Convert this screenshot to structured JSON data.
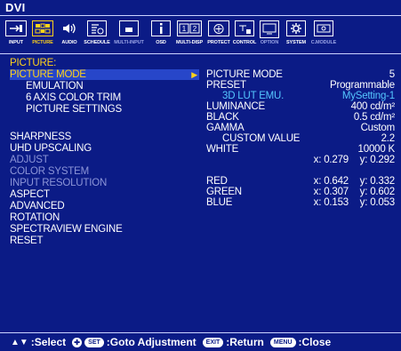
{
  "title": "DVI",
  "toolbar": [
    {
      "label": "INPUT",
      "icon": "input-icon"
    },
    {
      "label": "PICTURE",
      "icon": "picture-icon"
    },
    {
      "label": "AUDIO",
      "icon": "audio-icon"
    },
    {
      "label": "SCHEDULE",
      "icon": "schedule-icon"
    },
    {
      "label": "MULTI-INPUT",
      "icon": "multi-input-icon"
    },
    {
      "label": "OSD",
      "icon": "osd-icon"
    },
    {
      "label": "MULTI-DISP",
      "icon": "multi-display-icon"
    },
    {
      "label": "PROTECT",
      "icon": "protect-icon"
    },
    {
      "label": "CONTROL",
      "icon": "control-icon"
    },
    {
      "label": "OPTION",
      "icon": "option-icon"
    },
    {
      "label": "SYSTEM",
      "icon": "system-icon"
    },
    {
      "label": "C.MODULE",
      "icon": "compute-module-icon"
    }
  ],
  "menu": {
    "header": "PICTURE:",
    "items": [
      {
        "label": "PICTURE MODE"
      },
      {
        "label": "EMULATION"
      },
      {
        "label": "6 AXIS COLOR TRIM"
      },
      {
        "label": "PICTURE SETTINGS"
      },
      {
        "label": "SHARPNESS"
      },
      {
        "label": "UHD UPSCALING"
      },
      {
        "label": "ADJUST"
      },
      {
        "label": "COLOR SYSTEM"
      },
      {
        "label": "INPUT RESOLUTION"
      },
      {
        "label": "ASPECT"
      },
      {
        "label": "ADVANCED"
      },
      {
        "label": "ROTATION"
      },
      {
        "label": "SPECTRAVIEW ENGINE"
      },
      {
        "label": "RESET"
      }
    ]
  },
  "details": {
    "picture_mode": {
      "label": "PICTURE MODE",
      "value": "5"
    },
    "preset": {
      "label": "PRESET",
      "value": "Programmable"
    },
    "lut": {
      "label": "3D LUT EMU.",
      "value": "MySetting-1"
    },
    "luminance": {
      "label": "LUMINANCE",
      "value": "400 cd/m²"
    },
    "black": {
      "label": "BLACK",
      "value": "0.5 cd/m²"
    },
    "gamma": {
      "label": "GAMMA",
      "value": "Custom"
    },
    "custom_value": {
      "label": "CUSTOM VALUE",
      "value": "2.2"
    },
    "white": {
      "label": "WHITE",
      "value": "10000 K",
      "x": "x: 0.279",
      "y": "y: 0.292"
    },
    "red": {
      "label": "RED",
      "x": "x: 0.642",
      "y": "y: 0.332"
    },
    "green": {
      "label": "GREEN",
      "x": "x: 0.307",
      "y": "y: 0.602"
    },
    "blue": {
      "label": "BLUE",
      "x": "x: 0.153",
      "y": "y: 0.053"
    }
  },
  "help": {
    "select": ":Select",
    "set_key": "SET",
    "goto": ":Goto Adjustment",
    "exit_key": "EXIT",
    "return": ":Return",
    "menu_key": "MENU",
    "close": ":Close"
  },
  "colors": {
    "background": "#0b1b86",
    "highlight": "#2746c9",
    "selected": "#ffd21a",
    "accent": "#55c7ff",
    "disabled": "#8c95d8"
  }
}
